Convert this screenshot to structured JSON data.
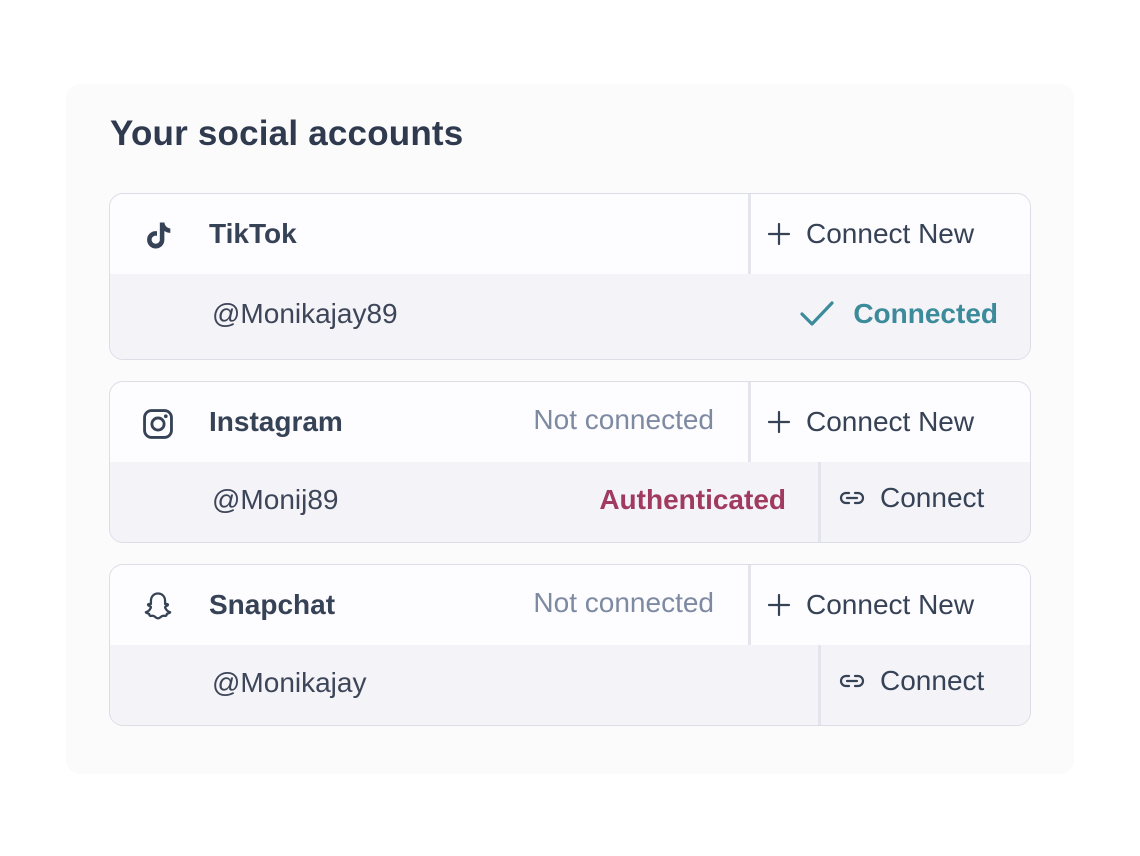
{
  "title": "Your social accounts",
  "colors": {
    "connected": "#3c8b9a",
    "authenticated": "#a13a5f",
    "muted": "#7d8aa2",
    "text": "#364256"
  },
  "accounts": [
    {
      "icon": "tiktok-icon",
      "name": "TikTok",
      "status": "",
      "connect_new_label": "Connect New",
      "handle": "@Monikajay89",
      "handle_status": "Connected",
      "handle_action": ""
    },
    {
      "icon": "instagram-icon",
      "name": "Instagram",
      "status": "Not connected",
      "connect_new_label": "Connect New",
      "handle": "@Monij89",
      "handle_status": "Authenticated",
      "handle_action": "Connect"
    },
    {
      "icon": "snapchat-icon",
      "name": "Snapchat",
      "status": "Not connected",
      "connect_new_label": "Connect New",
      "handle": "@Monikajay",
      "handle_status": "",
      "handle_action": "Connect"
    }
  ]
}
